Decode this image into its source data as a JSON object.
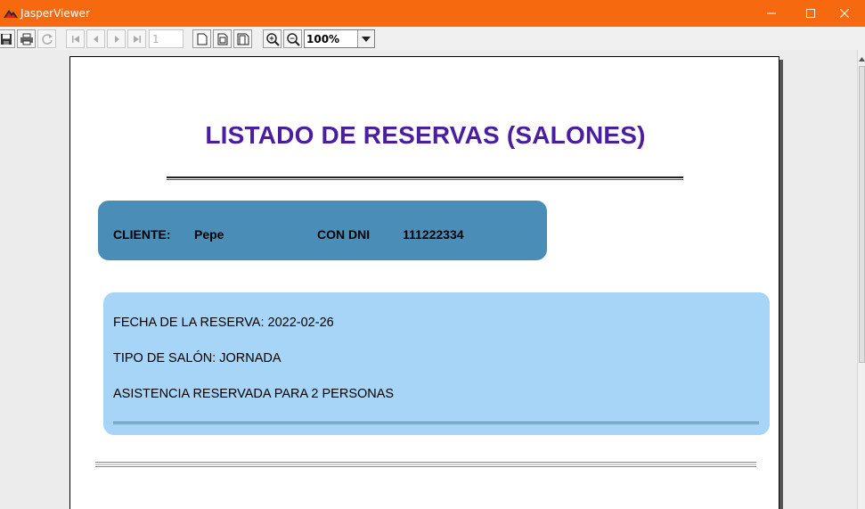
{
  "window": {
    "title": "JasperViewer"
  },
  "toolbar": {
    "page_number": "1",
    "zoom": "100%",
    "icons": [
      "save-icon",
      "print-icon",
      "reload-icon",
      "first-page-icon",
      "previous-page-icon",
      "next-page-icon",
      "last-page-icon",
      "actual-size-icon",
      "fit-page-icon",
      "fit-width-icon",
      "zoom-in-icon",
      "zoom-out-icon"
    ]
  },
  "report": {
    "title": "LISTADO DE RESERVAS (SALONES)",
    "client_label": "CLIENTE:",
    "client_name": "Pepe",
    "dni_label": "CON DNI",
    "dni_value": "111222334",
    "reservation": {
      "date_line": "FECHA DE LA RESERVA: 2022-02-26",
      "type_line": "TIPO DE SALÓN: JORNADA",
      "attendance_line": "ASISTENCIA RESERVADA PARA 2 PERSONAS"
    }
  },
  "colors": {
    "titlebar": "#f7690f",
    "title_text": "#4b1da0",
    "client_box": "#4a8db6",
    "reservation_box": "#a6d5f7"
  }
}
